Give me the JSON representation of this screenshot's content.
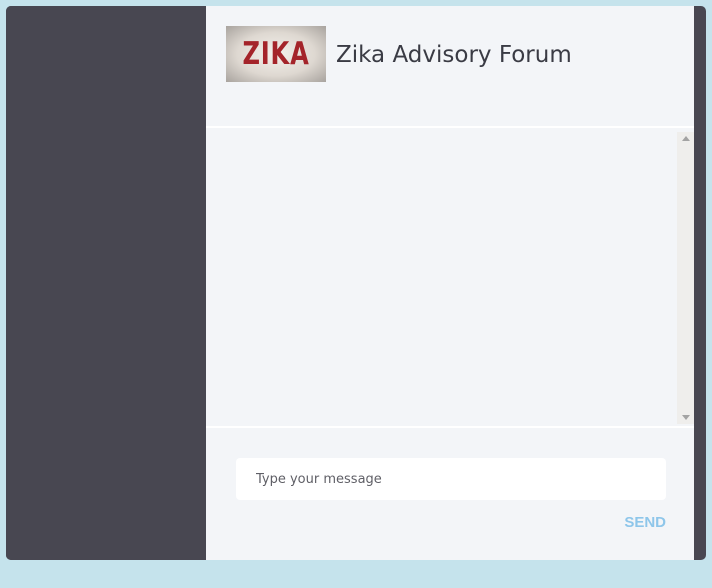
{
  "header": {
    "logo_text": "ZIKA",
    "title": "Zika Advisory Forum"
  },
  "composer": {
    "placeholder": "Type your message",
    "value": "",
    "send_label": "SEND"
  },
  "colors": {
    "page_background": "#c5e3ec",
    "sidebar": "#484751",
    "panel": "#f3f5f8",
    "send_accent": "#8ec6ea",
    "logo_red": "#a4242a"
  },
  "icons": [
    "scroll-up-arrow-icon",
    "scroll-down-arrow-icon"
  ]
}
